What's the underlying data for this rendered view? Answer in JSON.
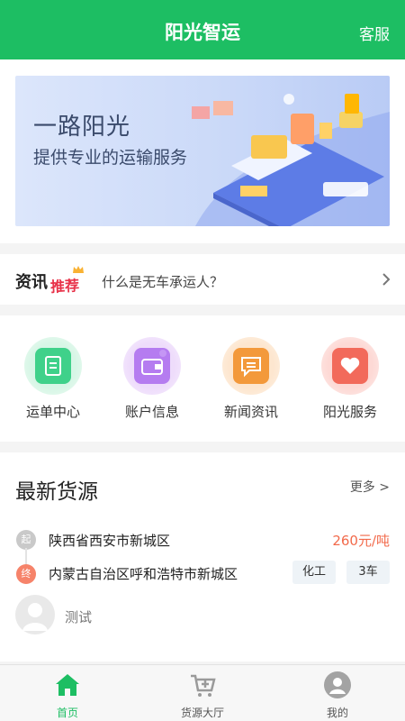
{
  "header": {
    "title": "阳光智运",
    "service_label": "客服"
  },
  "banner": {
    "headline": "一路阳光",
    "subline": "提供专业的运输服务"
  },
  "news": {
    "tag_main": "资讯",
    "tag_sub": "推荐",
    "text": "什么是无车承运人？"
  },
  "menu": {
    "items": [
      {
        "label": "运单中心",
        "icon": "receipt-icon",
        "color": "#3fd18a"
      },
      {
        "label": "账户信息",
        "icon": "wallet-icon",
        "color": "#b57cf0"
      },
      {
        "label": "新闻资讯",
        "icon": "message-icon",
        "color": "#f3993b"
      },
      {
        "label": "阳光服务",
        "icon": "heart-icon",
        "color": "#f26a5b"
      }
    ]
  },
  "cargo": {
    "title": "最新货源",
    "more_label": "更多 >",
    "entry": {
      "from_badge": "起",
      "to_badge": "终",
      "from": "陕西省西安市新城区",
      "to": "内蒙古自治区呼和浩特市新城区",
      "price": "260元/吨",
      "cargo_type": "化工",
      "vehicles": "3车",
      "user": "测试"
    }
  },
  "tabbar": {
    "items": [
      {
        "label": "首页",
        "icon": "home-icon",
        "active": true
      },
      {
        "label": "货源大厅",
        "icon": "cart-icon",
        "active": false
      },
      {
        "label": "我的",
        "icon": "user-icon",
        "active": false
      }
    ]
  },
  "colors": {
    "brand": "#1dbe63",
    "price": "#f26a4b"
  }
}
